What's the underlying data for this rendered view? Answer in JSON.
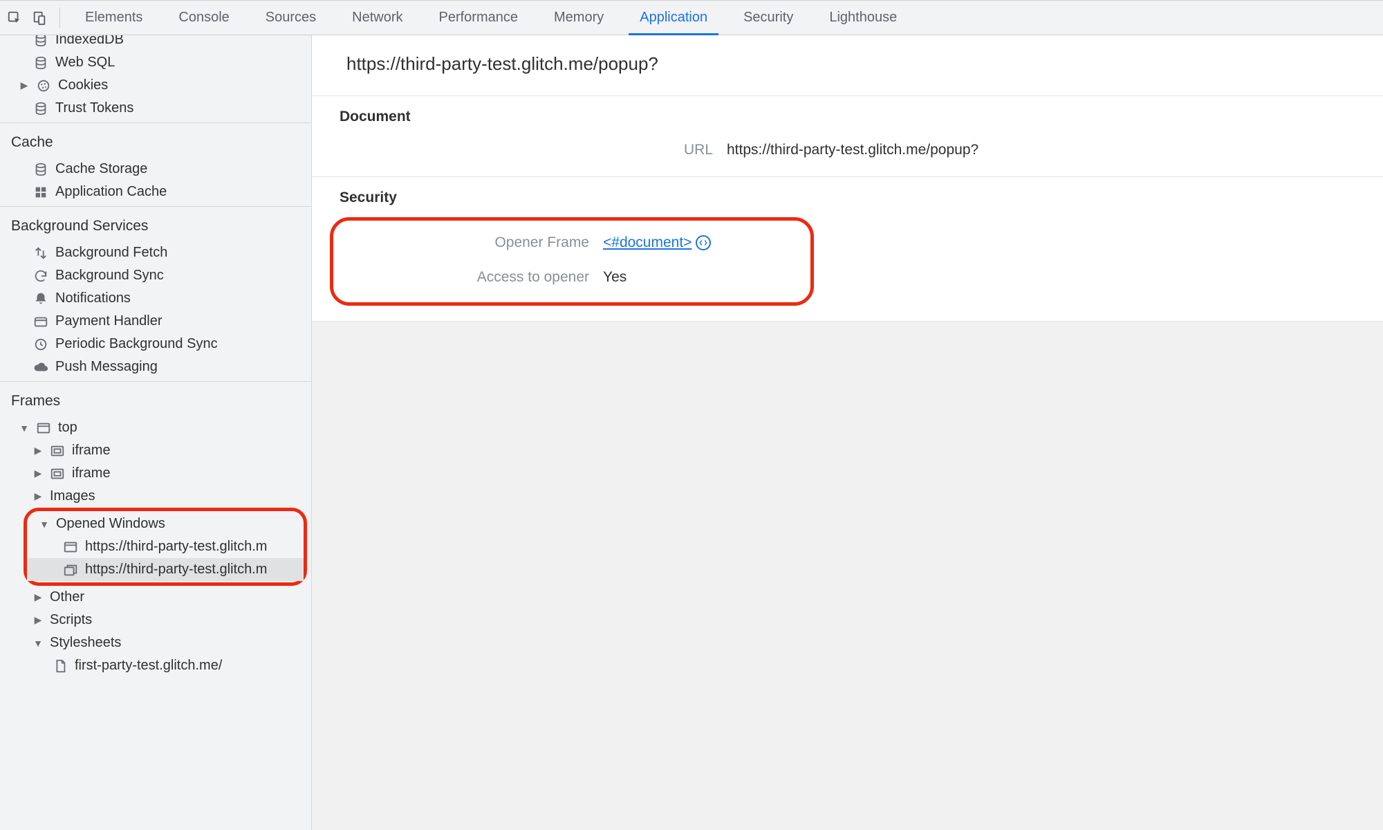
{
  "tabs": {
    "elements": "Elements",
    "console": "Console",
    "sources": "Sources",
    "network": "Network",
    "performance": "Performance",
    "memory": "Memory",
    "application": "Application",
    "security": "Security",
    "lighthouse": "Lighthouse"
  },
  "sidebar": {
    "storage": {
      "indexeddb": "IndexedDB",
      "websql": "Web SQL",
      "cookies": "Cookies",
      "trusttokens": "Trust Tokens"
    },
    "cache_header": "Cache",
    "cache": {
      "cachestorage": "Cache Storage",
      "appcache": "Application Cache"
    },
    "bgservices_header": "Background Services",
    "bg": {
      "bgfetch": "Background Fetch",
      "bgsync": "Background Sync",
      "notifications": "Notifications",
      "paymenthandler": "Payment Handler",
      "periodicbgsync": "Periodic Background Sync",
      "pushmsg": "Push Messaging"
    },
    "frames_header": "Frames",
    "frames": {
      "top": "top",
      "iframe1": "iframe",
      "iframe2": "iframe",
      "images": "Images",
      "openedwindows": "Opened Windows",
      "ow1": "https://third-party-test.glitch.m",
      "ow2": "https://third-party-test.glitch.m",
      "other": "Other",
      "scripts": "Scripts",
      "stylesheets": "Stylesheets",
      "ss1": "first-party-test.glitch.me/"
    }
  },
  "main": {
    "title": "https://third-party-test.glitch.me/popup?",
    "document_header": "Document",
    "url_label": "URL",
    "url_value": "https://third-party-test.glitch.me/popup?",
    "security_header": "Security",
    "opener_frame_label": "Opener Frame",
    "opener_frame_value": "<#document>",
    "access_label": "Access to opener",
    "access_value": "Yes"
  }
}
